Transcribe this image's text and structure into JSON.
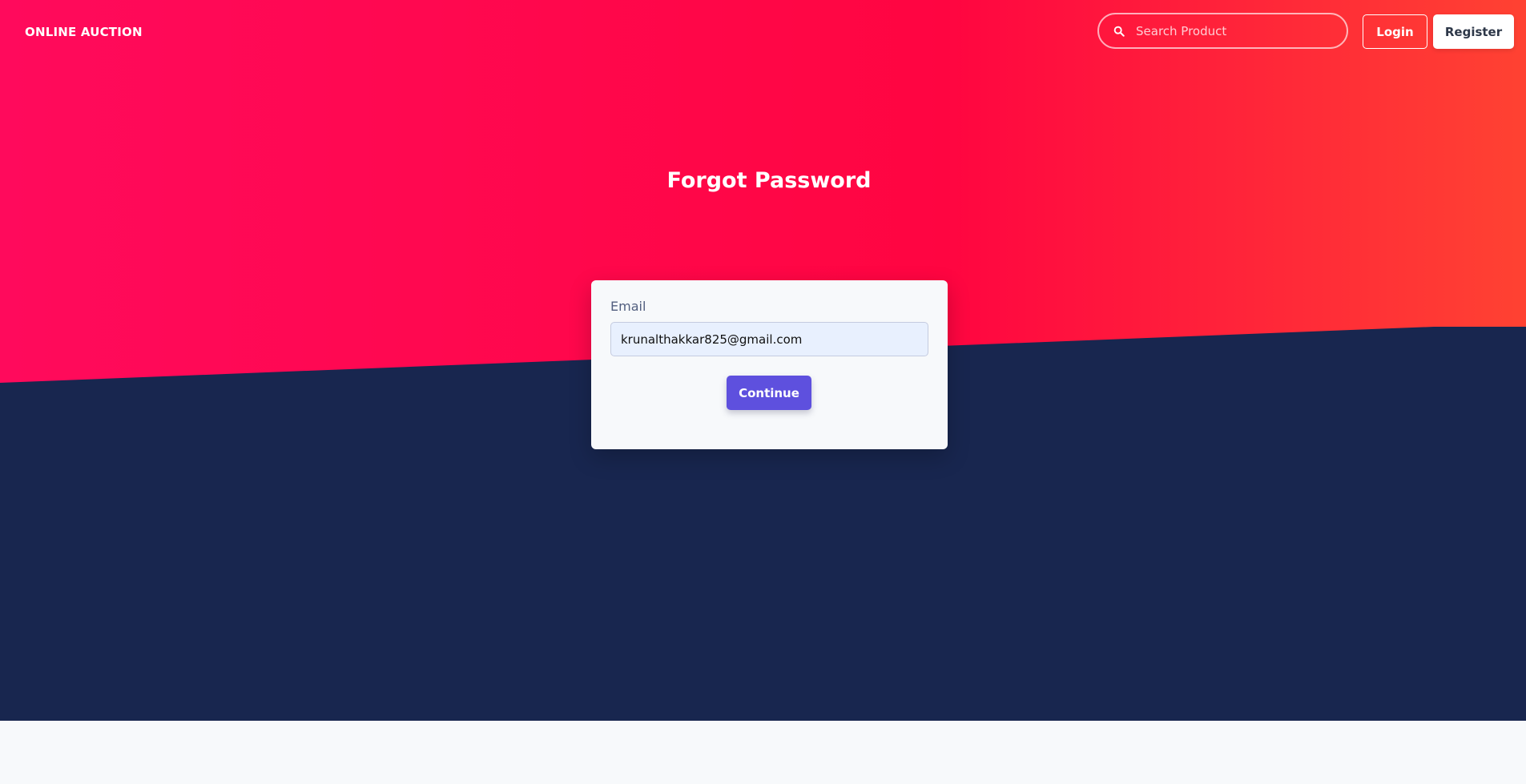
{
  "navbar": {
    "brand": "ONLINE AUCTION",
    "search_placeholder": "Search Product",
    "login_label": "Login",
    "register_label": "Register",
    "icons": {
      "search": "search-icon"
    }
  },
  "page": {
    "title": "Forgot Password"
  },
  "form": {
    "email_label": "Email",
    "email_value": "krunalthakkar825@gmail.com",
    "continue_label": "Continue"
  },
  "colors": {
    "hero_gradient_start": "#ff0a5c",
    "hero_gradient_end": "#ff4232",
    "hero_dark": "#18264f",
    "primary_button": "#5e50de",
    "page_background": "#f7f9fb"
  }
}
